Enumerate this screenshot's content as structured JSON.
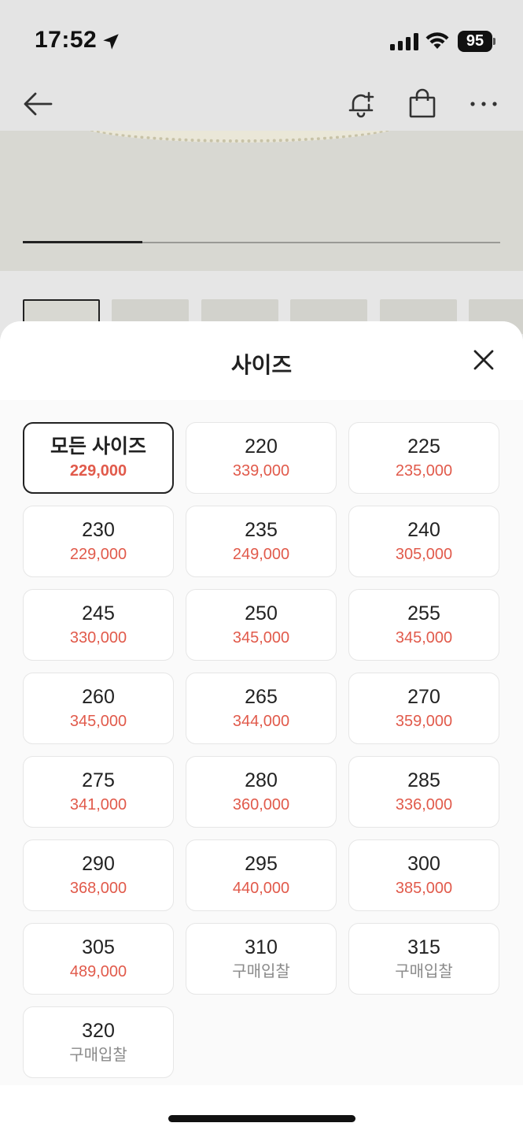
{
  "status_bar": {
    "time": "17:52",
    "battery": "95"
  },
  "nav": {
    "back_icon": "arrow-left-icon",
    "restock_icon": "bell-plus-icon",
    "bag_icon": "shopping-bag-icon",
    "more_icon": "more-horizontal-icon"
  },
  "gallery": {
    "progress": 0.25
  },
  "sheet": {
    "title": "사이즈",
    "close_icon": "close-icon",
    "sizes": [
      {
        "label": "모든 사이즈",
        "price": "229,000",
        "selected": true
      },
      {
        "label": "220",
        "price": "339,000"
      },
      {
        "label": "225",
        "price": "235,000"
      },
      {
        "label": "230",
        "price": "229,000"
      },
      {
        "label": "235",
        "price": "249,000"
      },
      {
        "label": "240",
        "price": "305,000"
      },
      {
        "label": "245",
        "price": "330,000"
      },
      {
        "label": "250",
        "price": "345,000"
      },
      {
        "label": "255",
        "price": "345,000"
      },
      {
        "label": "260",
        "price": "345,000"
      },
      {
        "label": "265",
        "price": "344,000"
      },
      {
        "label": "270",
        "price": "359,000"
      },
      {
        "label": "275",
        "price": "341,000"
      },
      {
        "label": "280",
        "price": "360,000"
      },
      {
        "label": "285",
        "price": "336,000"
      },
      {
        "label": "290",
        "price": "368,000"
      },
      {
        "label": "295",
        "price": "440,000"
      },
      {
        "label": "300",
        "price": "385,000"
      },
      {
        "label": "305",
        "price": "489,000"
      },
      {
        "label": "310",
        "price": "구매입찰",
        "bid": true
      },
      {
        "label": "315",
        "price": "구매입찰",
        "bid": true
      },
      {
        "label": "320",
        "price": "구매입찰",
        "bid": true
      }
    ]
  },
  "colors": {
    "price": "#e15a4b",
    "bid": "#8a8a8a",
    "selected_border": "#222222"
  }
}
